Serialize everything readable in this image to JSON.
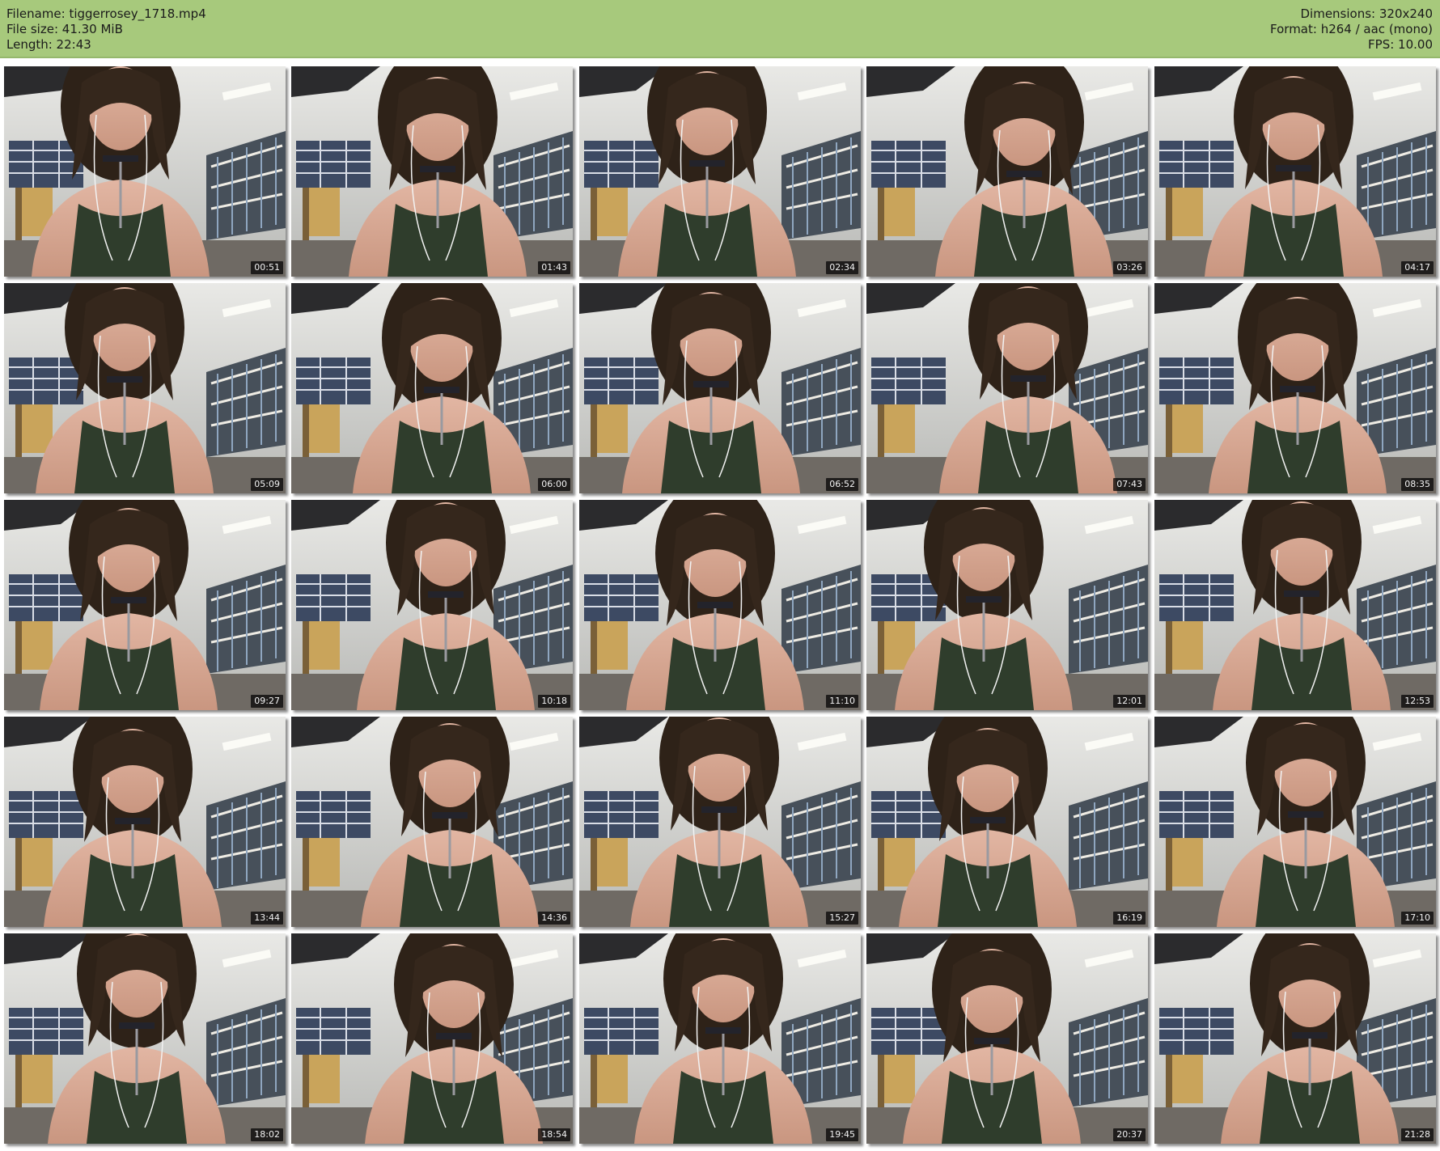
{
  "header": {
    "left": [
      "Filename: tiggerrosey_1718.mp4",
      "File size: 41.30 MiB",
      "Length: 22:43"
    ],
    "right": [
      "Dimensions: 320x240",
      "Format: h264 / aac (mono)",
      "FPS: 10.00"
    ],
    "background": "#a7c97c"
  },
  "thumbnails": [
    {
      "timestamp": "00:51",
      "image": "webcam-frame-library-background"
    },
    {
      "timestamp": "01:43",
      "image": "webcam-frame-library-background"
    },
    {
      "timestamp": "02:34",
      "image": "webcam-frame-library-background"
    },
    {
      "timestamp": "03:26",
      "image": "webcam-frame-library-background"
    },
    {
      "timestamp": "04:17",
      "image": "webcam-frame-library-background"
    },
    {
      "timestamp": "05:09",
      "image": "webcam-frame-library-background"
    },
    {
      "timestamp": "06:00",
      "image": "webcam-frame-library-background"
    },
    {
      "timestamp": "06:52",
      "image": "webcam-frame-library-background"
    },
    {
      "timestamp": "07:43",
      "image": "webcam-frame-library-background"
    },
    {
      "timestamp": "08:35",
      "image": "webcam-frame-library-background"
    },
    {
      "timestamp": "09:27",
      "image": "webcam-frame-library-background"
    },
    {
      "timestamp": "10:18",
      "image": "webcam-frame-library-background"
    },
    {
      "timestamp": "11:10",
      "image": "webcam-frame-library-background"
    },
    {
      "timestamp": "12:01",
      "image": "webcam-frame-library-background"
    },
    {
      "timestamp": "12:53",
      "image": "webcam-frame-library-background"
    },
    {
      "timestamp": "13:44",
      "image": "webcam-frame-library-background"
    },
    {
      "timestamp": "14:36",
      "image": "webcam-frame-library-background"
    },
    {
      "timestamp": "15:27",
      "image": "webcam-frame-library-background"
    },
    {
      "timestamp": "16:19",
      "image": "webcam-frame-library-background"
    },
    {
      "timestamp": "17:10",
      "image": "webcam-frame-library-background"
    },
    {
      "timestamp": "18:02",
      "image": "webcam-frame-library-background"
    },
    {
      "timestamp": "18:54",
      "image": "webcam-frame-library-background"
    },
    {
      "timestamp": "19:45",
      "image": "webcam-frame-library-background"
    },
    {
      "timestamp": "20:37",
      "image": "webcam-frame-library-background"
    },
    {
      "timestamp": "21:28",
      "image": "webcam-frame-library-background"
    }
  ]
}
